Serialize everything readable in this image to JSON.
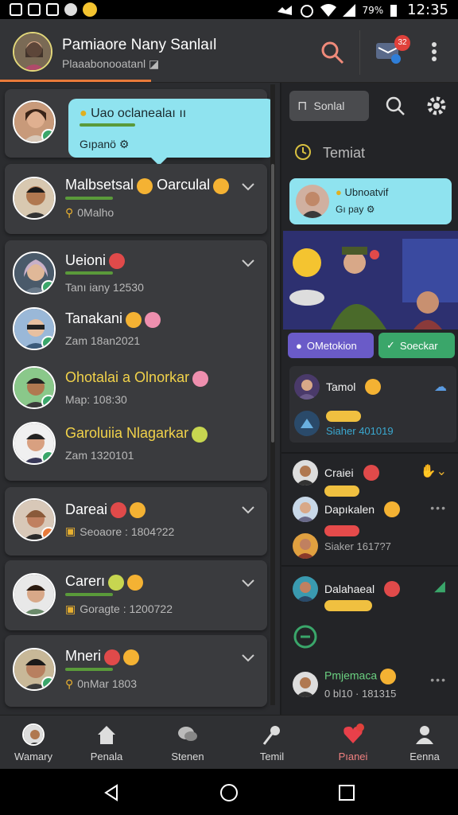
{
  "status": {
    "time": "12:35",
    "battery": "79%"
  },
  "header": {
    "name": "Pamiaore Nany Sanlaıl",
    "subtitle": "Plaaabonooatanl",
    "badge": "32"
  },
  "bubble": {
    "line1": "Uao oclanealaı ıı",
    "line2": "Gıpanö"
  },
  "chats": [
    {
      "name": "Malbsetsal",
      "name2": "Oarculal",
      "sub": "0Malho"
    },
    {
      "name": "Ueioni",
      "sub": "Tanı iany 12530"
    },
    {
      "name": "Tanakani",
      "sub": "Zam 18an2021"
    },
    {
      "name": "Ohotalai a Olnorkar",
      "sub": "Map: 108:30"
    },
    {
      "name": "Garoluiia Nlagarkar",
      "sub": "Zam 1320101"
    },
    {
      "name": "Dareai",
      "sub": "Seoaore : 1804?22"
    },
    {
      "name": "Carerı",
      "sub": "Goragte : 1200722"
    },
    {
      "name": "Mneri",
      "sub": "0nMar 1803"
    }
  ],
  "right": {
    "tab": "Sonlal",
    "title": "Temiat",
    "bubble": {
      "line1": "Ubnoatvif",
      "line2": "Gı pay"
    },
    "media_btn_a": "OMetokion",
    "media_btn_b": "Soeckar",
    "item1": {
      "name": "Tamol"
    },
    "item1sub": "Siaher 401019",
    "item2": {
      "name": "Craiei"
    },
    "item3": {
      "name": "Dapıkalen"
    },
    "item3sub": "Siaker 1617?7",
    "item4": {
      "name": "Dalahaeal"
    },
    "item5": {
      "name": "Pmjemaca",
      "sub": "0 bl10 · 181315"
    }
  },
  "nav": [
    {
      "label": "Wamary"
    },
    {
      "label": "Penala"
    },
    {
      "label": "Stenen"
    },
    {
      "label": "Temil"
    },
    {
      "label": "Pıanei"
    },
    {
      "label": "Eenna"
    }
  ],
  "colors": {
    "accent": "#e87a3a",
    "bubble": "#8fe3ef",
    "online": "#3aa66a",
    "active_nav": "#f08080"
  }
}
